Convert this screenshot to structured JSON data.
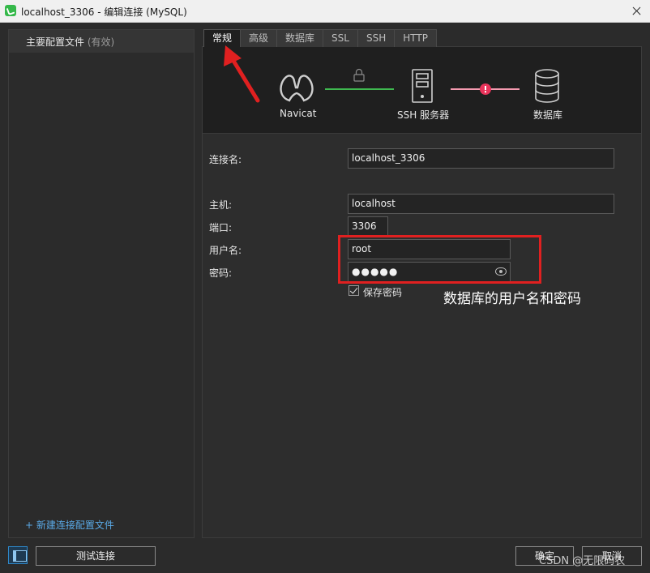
{
  "window": {
    "title": "localhost_3306 - 编辑连接 (MySQL)"
  },
  "left_panel": {
    "profile_name": "主要配置文件",
    "profile_status": "(有效)",
    "new_profile_link": "+ 新建连接配置文件"
  },
  "tabs": [
    {
      "label": "常规",
      "active": true
    },
    {
      "label": "高级"
    },
    {
      "label": "数据库"
    },
    {
      "label": "SSL"
    },
    {
      "label": "SSH"
    },
    {
      "label": "HTTP"
    }
  ],
  "diagram": {
    "nodes": [
      {
        "label": "Navicat",
        "icon": "navicat-logo-icon"
      },
      {
        "label": "SSH 服务器",
        "icon": "server-icon"
      },
      {
        "label": "数据库",
        "icon": "database-icon"
      }
    ],
    "colors": {
      "ok_line": "#3fb950",
      "err_line": "#f59ab0",
      "err_dot": "#e8335a"
    }
  },
  "form": {
    "connection_name": {
      "label": "连接名:",
      "value": "localhost_3306"
    },
    "host": {
      "label": "主机:",
      "value": "localhost"
    },
    "port": {
      "label": "端口:",
      "value": "3306"
    },
    "username": {
      "label": "用户名:",
      "value": "root"
    },
    "password": {
      "label": "密码:",
      "value": "●●●●●"
    },
    "save_password": {
      "label": "保存密码",
      "checked": true
    }
  },
  "annotation": {
    "text": "数据库的用户名和密码",
    "color": "#e02020"
  },
  "buttons": {
    "test_connection": "测试连接",
    "ok": "确定",
    "cancel": "取消"
  },
  "watermark": "CSDN @无限码农"
}
